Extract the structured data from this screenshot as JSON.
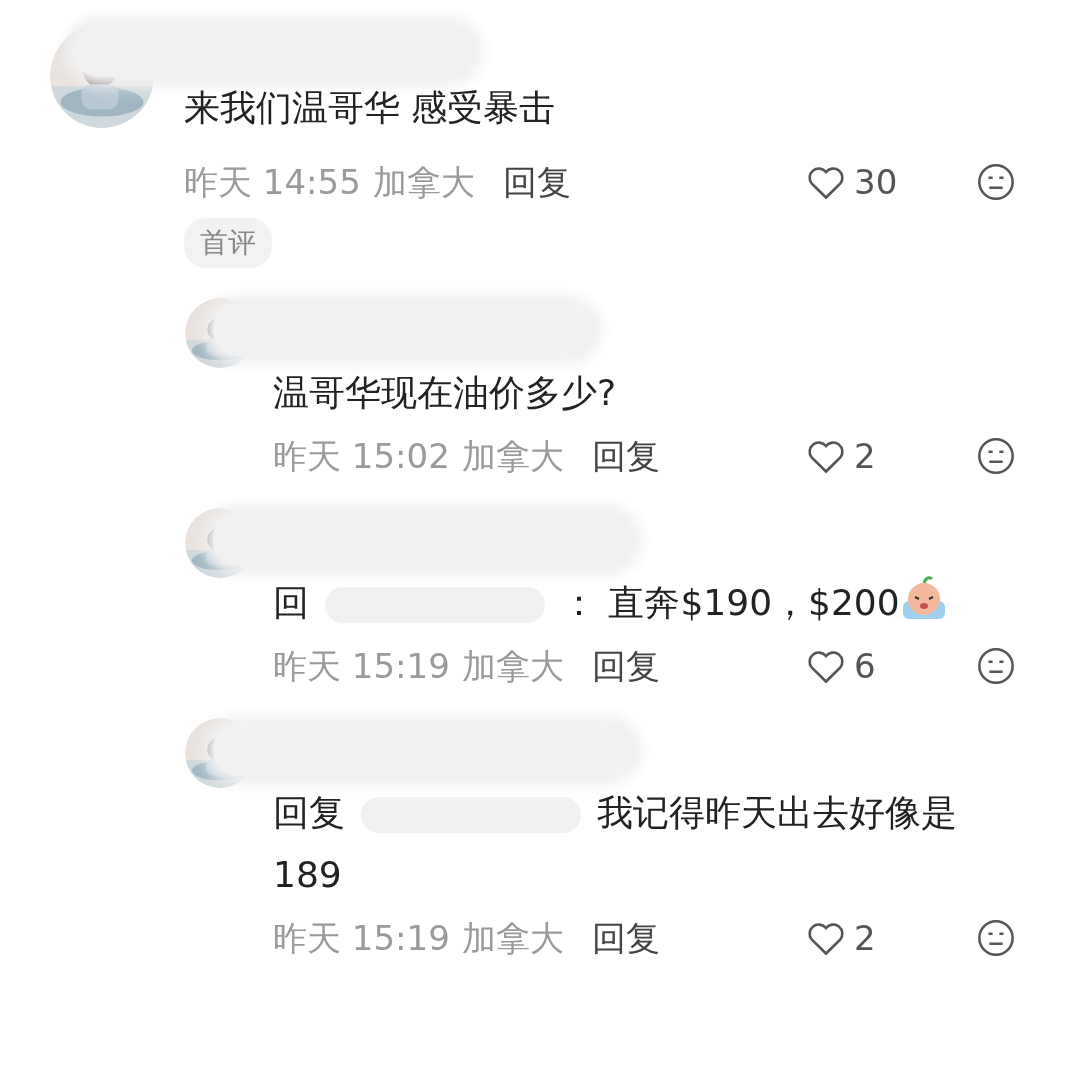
{
  "comments": [
    {
      "body": "来我们温哥华 感受暴击",
      "time": "昨天 14:55",
      "location": "加拿大",
      "reply_label": "回复",
      "likes": "30",
      "badge": "首评",
      "children": [
        {
          "body": "温哥华现在油价多少?",
          "time": "昨天 15:02",
          "location": "加拿大",
          "reply_label": "回复",
          "likes": "2"
        },
        {
          "reply_prefix": "回",
          "body": "： 直奔$190，$200",
          "emoji": true,
          "time": "昨天 15:19",
          "location": "加拿大",
          "reply_label": "回复",
          "likes": "6"
        },
        {
          "reply_prefix": "回复",
          "body": "我记得昨天出去好像是189",
          "time": "昨天 15:19",
          "location": "加拿大",
          "reply_label": "回复",
          "likes": "2"
        }
      ]
    }
  ]
}
